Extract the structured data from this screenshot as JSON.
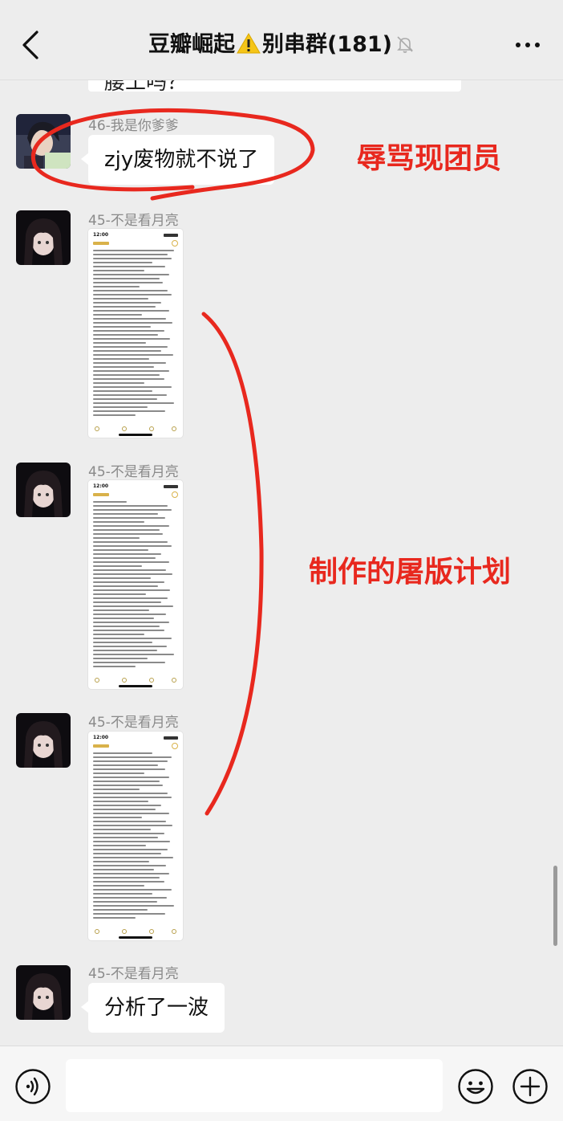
{
  "header": {
    "title_prefix": "豆瓣崛起",
    "title_suffix": "别串群",
    "member_count": "(181)"
  },
  "previous_message": {
    "text_fragment": "腰工吗？"
  },
  "messages": [
    {
      "sender": "46-我是你爹爹",
      "type": "text",
      "text": "zjy废物就不说了"
    },
    {
      "sender": "45-不是看月亮",
      "type": "image",
      "image": "phone-notes-screenshot"
    },
    {
      "sender": "45-不是看月亮",
      "type": "image",
      "image": "phone-notes-screenshot"
    },
    {
      "sender": "45-不是看月亮",
      "type": "image",
      "image": "phone-notes-screenshot"
    },
    {
      "sender": "45-不是看月亮",
      "type": "text",
      "text": "分析了一波"
    }
  ],
  "screenshot_status_time": "12:00",
  "annotations": {
    "label1": "辱骂现团员",
    "label2": "制作的屠版计划"
  },
  "input_bar": {
    "placeholder": "",
    "icons": [
      "voice-icon",
      "emoji-icon",
      "plus-icon"
    ]
  },
  "colors": {
    "annotation_red": "#e8281e",
    "background": "#ededed",
    "bubble": "#ffffff",
    "warning_yellow": "#f5c518"
  }
}
